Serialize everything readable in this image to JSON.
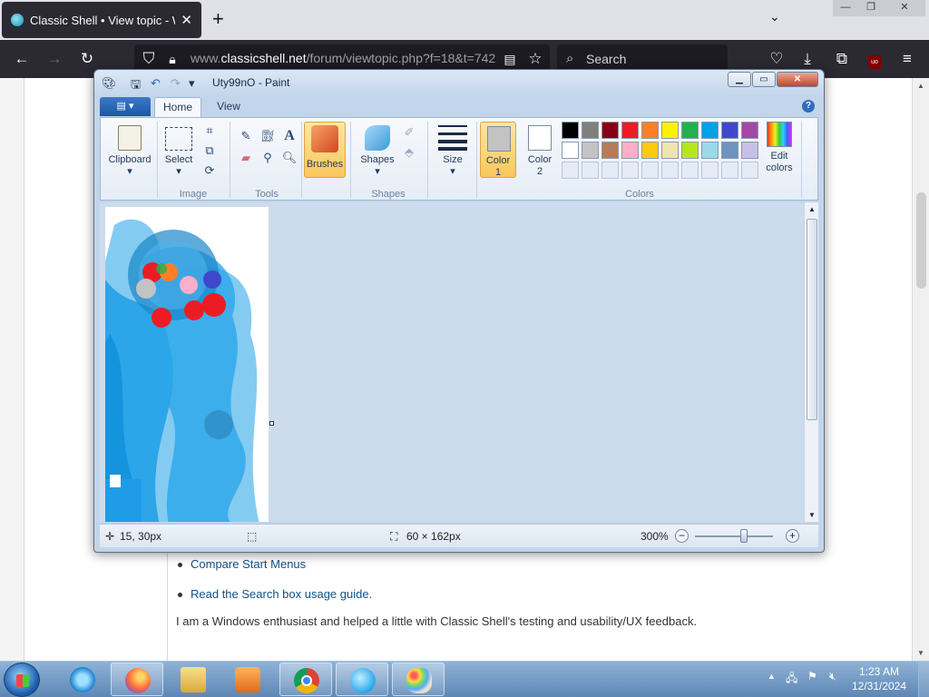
{
  "browser": {
    "tab_title": "Classic Shell • View topic - Wind",
    "url_prefix": "www.",
    "url_host": "classicshell.net",
    "url_path": "/forum/viewtopic.php?f=18&t=742",
    "search_placeholder": "Search"
  },
  "page": {
    "links": [
      "Compare Start Menus",
      "Read the Search box usage guide."
    ],
    "paragraph": "I am a Windows enthusiast and helped a little with Classic Shell's testing and usability/UX feedback."
  },
  "paint": {
    "title": "Uty99nO - Paint",
    "tabs": {
      "file": "▤ ▾",
      "home": "Home",
      "view": "View"
    },
    "groups": {
      "clipboard": "Clipboard",
      "select": "Select",
      "image": "Image",
      "tools": "Tools",
      "brushes": "Brushes",
      "shapes_btn": "Shapes",
      "shapes": "Shapes",
      "size": "Size",
      "color1": "Color\n1",
      "color2": "Color\n2",
      "colors": "Colors",
      "edit_colors": "Edit\ncolors"
    },
    "color1_value": "#c3c3c3",
    "color2_value": "#ffffff",
    "palette_row1": [
      "#000000",
      "#7f7f7f",
      "#880015",
      "#ed1c24",
      "#ff7f27",
      "#fff200",
      "#22b14c",
      "#00a2e8",
      "#3f48cc",
      "#a349a4"
    ],
    "palette_row2": [
      "#ffffff",
      "#c3c3c3",
      "#b97a57",
      "#ffaec9",
      "#ffc90e",
      "#efe4b0",
      "#b5e61d",
      "#99d9ea",
      "#7092be",
      "#c8bfe7"
    ],
    "status": {
      "cursor": "15, 30px",
      "size": "60 × 162px",
      "zoom": "300%"
    }
  },
  "taskbar": {
    "clock_time": "1:23 AM",
    "clock_date": "12/31/2024"
  }
}
